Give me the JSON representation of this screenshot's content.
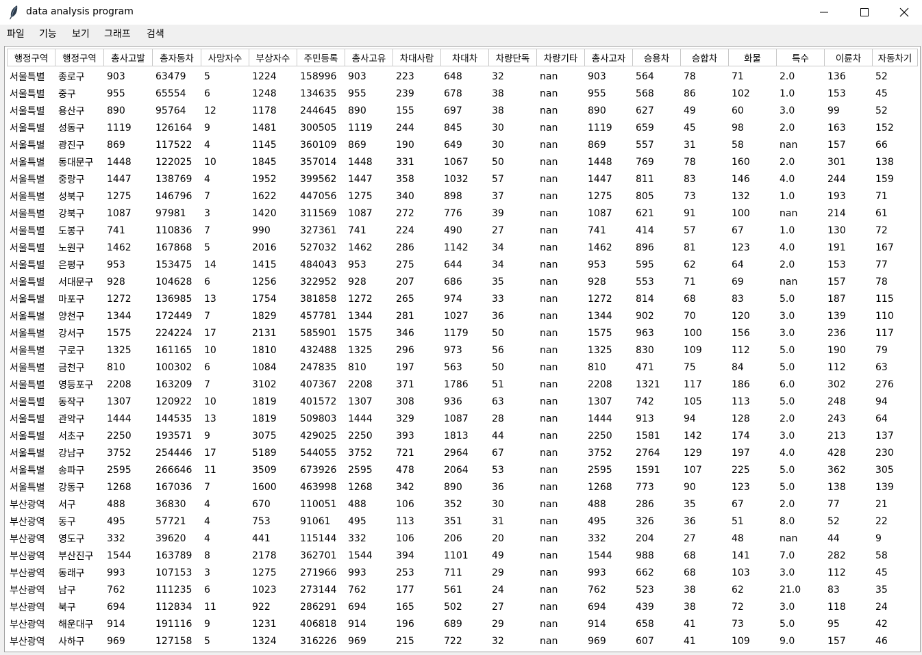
{
  "window": {
    "title": "data analysis program"
  },
  "menu": [
    "파일",
    "기능",
    "보기",
    "그래프",
    "검색"
  ],
  "table": {
    "columns": [
      "행정구역",
      "행정구역",
      "총사고발",
      "총자동차",
      "사망자수",
      "부상자수",
      "주민등록",
      "총사고유",
      "차대사람",
      "차대차",
      "차량단독",
      "차량기타",
      "총사고자",
      "승용차",
      "승합차",
      "화물",
      "특수",
      "이륜차",
      "자동차기"
    ],
    "rows": [
      [
        "서울특별",
        "종로구",
        "903",
        "63479",
        "5",
        "1224",
        "158996",
        "903",
        "223",
        "648",
        "32",
        "nan",
        "903",
        "564",
        "78",
        "71",
        "2.0",
        "136",
        "52"
      ],
      [
        "서울특별",
        "중구",
        "955",
        "65554",
        "6",
        "1248",
        "134635",
        "955",
        "239",
        "678",
        "38",
        "nan",
        "955",
        "568",
        "86",
        "102",
        "1.0",
        "153",
        "45"
      ],
      [
        "서울특별",
        "용산구",
        "890",
        "95764",
        "12",
        "1178",
        "244645",
        "890",
        "155",
        "697",
        "38",
        "nan",
        "890",
        "627",
        "49",
        "60",
        "3.0",
        "99",
        "52"
      ],
      [
        "서울특별",
        "성동구",
        "1119",
        "126164",
        "9",
        "1481",
        "300505",
        "1119",
        "244",
        "845",
        "30",
        "nan",
        "1119",
        "659",
        "45",
        "98",
        "2.0",
        "163",
        "152"
      ],
      [
        "서울특별",
        "광진구",
        "869",
        "117522",
        "4",
        "1145",
        "360109",
        "869",
        "190",
        "649",
        "30",
        "nan",
        "869",
        "557",
        "31",
        "58",
        "nan",
        "157",
        "66"
      ],
      [
        "서울특별",
        "동대문구",
        "1448",
        "122025",
        "10",
        "1845",
        "357014",
        "1448",
        "331",
        "1067",
        "50",
        "nan",
        "1448",
        "769",
        "78",
        "160",
        "2.0",
        "301",
        "138"
      ],
      [
        "서울특별",
        "중랑구",
        "1447",
        "138769",
        "4",
        "1952",
        "399562",
        "1447",
        "358",
        "1032",
        "57",
        "nan",
        "1447",
        "811",
        "83",
        "146",
        "4.0",
        "244",
        "159"
      ],
      [
        "서울특별",
        "성북구",
        "1275",
        "146796",
        "7",
        "1622",
        "447056",
        "1275",
        "340",
        "898",
        "37",
        "nan",
        "1275",
        "805",
        "73",
        "132",
        "1.0",
        "193",
        "71"
      ],
      [
        "서울특별",
        "강북구",
        "1087",
        "97981",
        "3",
        "1420",
        "311569",
        "1087",
        "272",
        "776",
        "39",
        "nan",
        "1087",
        "621",
        "91",
        "100",
        "nan",
        "214",
        "61"
      ],
      [
        "서울특별",
        "도봉구",
        "741",
        "110836",
        "7",
        "990",
        "327361",
        "741",
        "224",
        "490",
        "27",
        "nan",
        "741",
        "414",
        "57",
        "67",
        "1.0",
        "130",
        "72"
      ],
      [
        "서울특별",
        "노원구",
        "1462",
        "167868",
        "5",
        "2016",
        "527032",
        "1462",
        "286",
        "1142",
        "34",
        "nan",
        "1462",
        "896",
        "81",
        "123",
        "4.0",
        "191",
        "167"
      ],
      [
        "서울특별",
        "은평구",
        "953",
        "153475",
        "14",
        "1415",
        "484043",
        "953",
        "275",
        "644",
        "34",
        "nan",
        "953",
        "595",
        "62",
        "64",
        "2.0",
        "153",
        "77"
      ],
      [
        "서울특별",
        "서대문구",
        "928",
        "104628",
        "6",
        "1256",
        "322952",
        "928",
        "207",
        "686",
        "35",
        "nan",
        "928",
        "553",
        "71",
        "69",
        "nan",
        "157",
        "78"
      ],
      [
        "서울특별",
        "마포구",
        "1272",
        "136985",
        "13",
        "1754",
        "381858",
        "1272",
        "265",
        "974",
        "33",
        "nan",
        "1272",
        "814",
        "68",
        "83",
        "5.0",
        "187",
        "115"
      ],
      [
        "서울특별",
        "양천구",
        "1344",
        "172449",
        "7",
        "1829",
        "457781",
        "1344",
        "281",
        "1027",
        "36",
        "nan",
        "1344",
        "902",
        "70",
        "120",
        "3.0",
        "139",
        "110"
      ],
      [
        "서울특별",
        "강서구",
        "1575",
        "224224",
        "17",
        "2131",
        "585901",
        "1575",
        "346",
        "1179",
        "50",
        "nan",
        "1575",
        "963",
        "100",
        "156",
        "3.0",
        "236",
        "117"
      ],
      [
        "서울특별",
        "구로구",
        "1325",
        "161165",
        "10",
        "1810",
        "432488",
        "1325",
        "296",
        "973",
        "56",
        "nan",
        "1325",
        "830",
        "109",
        "112",
        "5.0",
        "190",
        "79"
      ],
      [
        "서울특별",
        "금천구",
        "810",
        "100302",
        "6",
        "1084",
        "247835",
        "810",
        "197",
        "563",
        "50",
        "nan",
        "810",
        "471",
        "75",
        "84",
        "5.0",
        "112",
        "63"
      ],
      [
        "서울특별",
        "영등포구",
        "2208",
        "163209",
        "7",
        "3102",
        "407367",
        "2208",
        "371",
        "1786",
        "51",
        "nan",
        "2208",
        "1321",
        "117",
        "186",
        "6.0",
        "302",
        "276"
      ],
      [
        "서울특별",
        "동작구",
        "1307",
        "120922",
        "10",
        "1819",
        "401572",
        "1307",
        "308",
        "936",
        "63",
        "nan",
        "1307",
        "742",
        "105",
        "113",
        "5.0",
        "248",
        "94"
      ],
      [
        "서울특별",
        "관악구",
        "1444",
        "144535",
        "13",
        "1819",
        "509803",
        "1444",
        "329",
        "1087",
        "28",
        "nan",
        "1444",
        "913",
        "94",
        "128",
        "2.0",
        "243",
        "64"
      ],
      [
        "서울특별",
        "서초구",
        "2250",
        "193571",
        "9",
        "3075",
        "429025",
        "2250",
        "393",
        "1813",
        "44",
        "nan",
        "2250",
        "1581",
        "142",
        "174",
        "3.0",
        "213",
        "137"
      ],
      [
        "서울특별",
        "강남구",
        "3752",
        "254446",
        "17",
        "5189",
        "544055",
        "3752",
        "721",
        "2964",
        "67",
        "nan",
        "3752",
        "2764",
        "129",
        "197",
        "4.0",
        "428",
        "230"
      ],
      [
        "서울특별",
        "송파구",
        "2595",
        "266646",
        "11",
        "3509",
        "673926",
        "2595",
        "478",
        "2064",
        "53",
        "nan",
        "2595",
        "1591",
        "107",
        "225",
        "5.0",
        "362",
        "305"
      ],
      [
        "서울특별",
        "강동구",
        "1268",
        "167036",
        "7",
        "1600",
        "463998",
        "1268",
        "342",
        "890",
        "36",
        "nan",
        "1268",
        "773",
        "90",
        "123",
        "5.0",
        "138",
        "139"
      ],
      [
        "부산광역",
        "서구",
        "488",
        "36830",
        "4",
        "670",
        "110051",
        "488",
        "106",
        "352",
        "30",
        "nan",
        "488",
        "286",
        "35",
        "67",
        "2.0",
        "77",
        "21"
      ],
      [
        "부산광역",
        "동구",
        "495",
        "57721",
        "4",
        "753",
        "91061",
        "495",
        "113",
        "351",
        "31",
        "nan",
        "495",
        "326",
        "36",
        "51",
        "8.0",
        "52",
        "22"
      ],
      [
        "부산광역",
        "영도구",
        "332",
        "39620",
        "4",
        "441",
        "115144",
        "332",
        "106",
        "206",
        "20",
        "nan",
        "332",
        "204",
        "27",
        "48",
        "nan",
        "44",
        "9"
      ],
      [
        "부산광역",
        "부산진구",
        "1544",
        "163789",
        "8",
        "2178",
        "362701",
        "1544",
        "394",
        "1101",
        "49",
        "nan",
        "1544",
        "988",
        "68",
        "141",
        "7.0",
        "282",
        "58"
      ],
      [
        "부산광역",
        "동래구",
        "993",
        "107153",
        "3",
        "1275",
        "271966",
        "993",
        "253",
        "711",
        "29",
        "nan",
        "993",
        "662",
        "68",
        "103",
        "3.0",
        "112",
        "45"
      ],
      [
        "부산광역",
        "남구",
        "762",
        "111235",
        "6",
        "1023",
        "273144",
        "762",
        "177",
        "561",
        "24",
        "nan",
        "762",
        "523",
        "38",
        "62",
        "21.0",
        "83",
        "35"
      ],
      [
        "부산광역",
        "북구",
        "694",
        "112834",
        "11",
        "922",
        "286291",
        "694",
        "165",
        "502",
        "27",
        "nan",
        "694",
        "439",
        "38",
        "72",
        "3.0",
        "118",
        "24"
      ],
      [
        "부산광역",
        "해운대구",
        "914",
        "191116",
        "9",
        "1231",
        "406818",
        "914",
        "196",
        "689",
        "29",
        "nan",
        "914",
        "658",
        "41",
        "73",
        "5.0",
        "95",
        "42"
      ],
      [
        "부산광역",
        "사하구",
        "969",
        "127158",
        "5",
        "1324",
        "316226",
        "969",
        "215",
        "722",
        "32",
        "nan",
        "969",
        "607",
        "41",
        "109",
        "9.0",
        "157",
        "46"
      ]
    ]
  }
}
